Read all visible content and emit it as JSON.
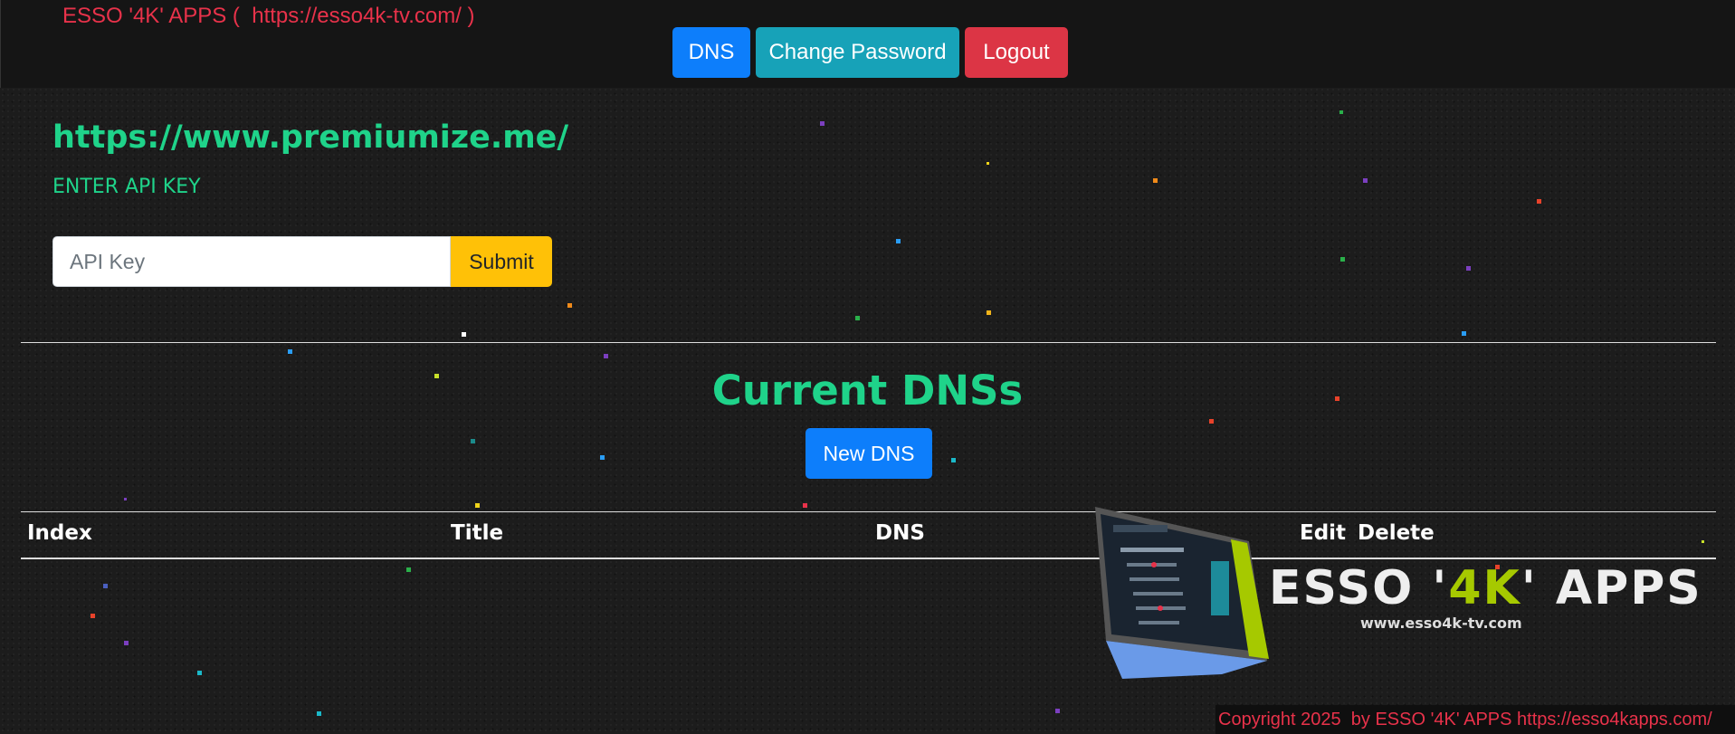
{
  "header": {
    "brand_text": "ESSO '4K' APPS (  https://esso4k-tv.com/ )",
    "nav": {
      "dns_label": "DNS",
      "change_password_label": "Change Password",
      "logout_label": "Logout"
    }
  },
  "api_section": {
    "site_url": "https://www.premiumize.me/",
    "prompt": "ENTER API KEY",
    "input_placeholder": "API Key",
    "input_value": "",
    "submit_label": "Submit"
  },
  "dns_section": {
    "title": "Current DNSs",
    "new_button_label": "New DNS",
    "table": {
      "headers": [
        "Index",
        "Title",
        "DNS",
        "Edit",
        "Delete"
      ],
      "rows": []
    }
  },
  "logo": {
    "text_prefix": "ESSO '",
    "text_accent": "4K",
    "text_suffix": "' APPS",
    "url": "www.esso4k-tv.com"
  },
  "footer": {
    "copyright": "Copyright 2025  by ESSO '4K' APPS https://esso4kapps.com/"
  },
  "colors": {
    "accent_green": "#1fd38a",
    "brand_red": "#e8324a",
    "primary_blue": "#0d7efb",
    "info_teal": "#17a2b8",
    "danger_red": "#dc3545",
    "warning_yellow": "#ffc107"
  }
}
